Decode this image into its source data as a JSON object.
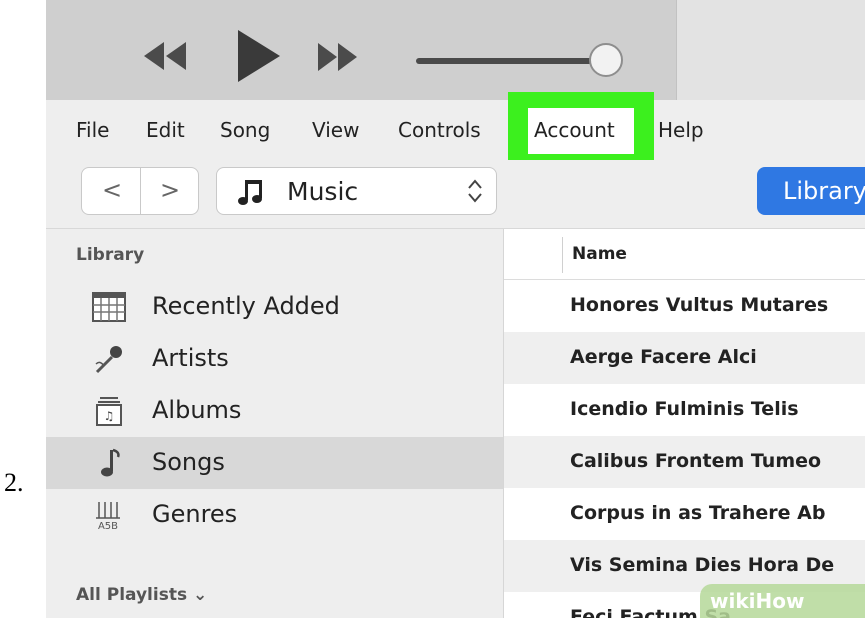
{
  "step_number": "2.",
  "menu": {
    "items": [
      "File",
      "Edit",
      "Song",
      "View",
      "Controls",
      "Account",
      "Help"
    ],
    "highlighted": "Account",
    "highlight_color": "#3cf01e"
  },
  "toolbar": {
    "icons": [
      "rewind-icon",
      "play-icon",
      "fast-forward-icon"
    ],
    "volume_fraction": 0.95
  },
  "nav": {
    "back_glyph": "<",
    "forward_glyph": ">",
    "media_type": "Music",
    "library_button": "Library"
  },
  "sidebar": {
    "heading": "Library",
    "items": [
      {
        "label": "Recently Added",
        "icon": "calendar-grid-icon"
      },
      {
        "label": "Artists",
        "icon": "microphone-icon"
      },
      {
        "label": "Albums",
        "icon": "album-icon"
      },
      {
        "label": "Songs",
        "icon": "music-note-icon",
        "selected": true
      },
      {
        "label": "Genres",
        "icon": "guitar-genre-icon"
      }
    ],
    "playlists_label": "All Playlists ⌄"
  },
  "songs": {
    "column": "Name",
    "rows": [
      "Honores Vultus Mutares",
      "Aerge Facere Alci",
      "Icendio Fulminis Telis",
      "Calibus Frontem Tumeo",
      "Corpus in as Trahere Ab",
      "Vis Semina Dies Hora De",
      "Feci Factum Sa"
    ]
  },
  "watermark": "wikiHow",
  "colors": {
    "accent_blue": "#2f78e3",
    "highlight_green": "#3cf01e"
  }
}
